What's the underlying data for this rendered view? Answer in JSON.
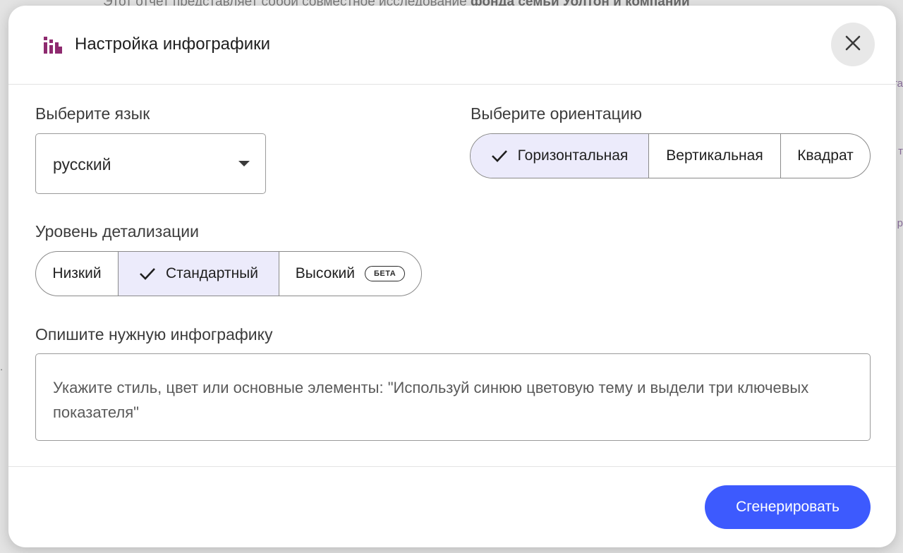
{
  "background": {
    "text_prefix": "Этот отчет представляет собой совместное исследование ",
    "text_bold": "фонда семьи Уолтон и компании",
    "edge_a": "та",
    "edge_b": "т",
    "edge_c": "р",
    "edge_d": "."
  },
  "dialog": {
    "title": "Настройка инфографики",
    "header_icon": "infographic-bars-icon",
    "close_icon": "close-icon"
  },
  "language": {
    "label": "Выберите язык",
    "value": "русский"
  },
  "orientation": {
    "label": "Выберите ориентацию",
    "options": [
      "Горизонтальная",
      "Вертикальная",
      "Квадрат"
    ],
    "selected": "Горизонтальная"
  },
  "detail": {
    "label": "Уровень детализации",
    "options": [
      "Низкий",
      "Стандартный",
      "Высокий"
    ],
    "selected": "Стандартный",
    "beta_badge": "БЕТА"
  },
  "description": {
    "label": "Опишите нужную инфографику",
    "placeholder": "Укажите стиль, цвет или основные элементы: \"Используй синюю цветовую тему и выдели три ключевых показателя\""
  },
  "actions": {
    "generate_label": "Сгенерировать"
  },
  "colors": {
    "accent": "#3d5afe",
    "selected_segment": "#ecebfb",
    "brand_icon": "#8e2a6f"
  }
}
